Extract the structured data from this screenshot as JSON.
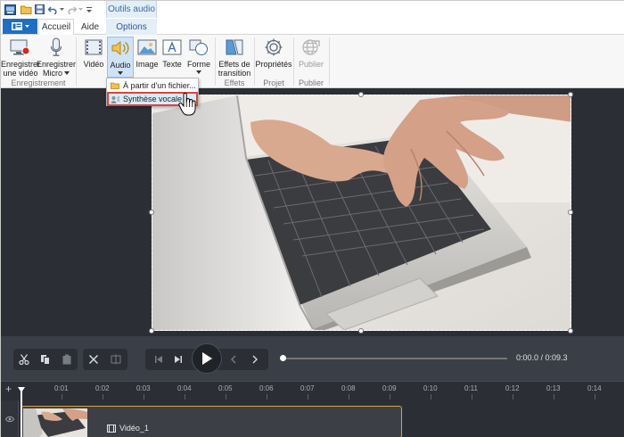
{
  "context_tab": {
    "title": "Outils audio",
    "tab": "Options"
  },
  "tabs": {
    "home": "Accueil",
    "help": "Aide"
  },
  "ribbon": {
    "record_screen": [
      "Enregistrer",
      "une vidéo"
    ],
    "record_mic": [
      "Enregistrer",
      "Micro"
    ],
    "video": "Vidéo",
    "audio": "Audio",
    "image": "Image",
    "text": "Texte",
    "shape": "Forme",
    "transitions": [
      "Effets de",
      "transition"
    ],
    "properties": "Propriétés",
    "publish": "Publier",
    "groups": {
      "recording": "Enregistrement",
      "effects": "Effets",
      "project": "Projet",
      "publish": "Publier"
    }
  },
  "audio_menu": {
    "from_file": "À partir d'un fichier...",
    "tts": "Synthèse vocale"
  },
  "transport": {
    "timecode": "0:00.0 / 0:09.3",
    "position": 0.0
  },
  "timeline": {
    "ticks": [
      "0:01",
      "0:02",
      "0:03",
      "0:04",
      "0:05",
      "0:06",
      "0:07",
      "0:08",
      "0:09",
      "0:10",
      "0:11",
      "0:12",
      "0:13",
      "0:14"
    ],
    "clip_name": "Vidéo_1"
  },
  "colors": {
    "accent": "#1e6fc4",
    "highlight_border": "#d9443c",
    "clip_border": "#d9a441",
    "dark_bg": "#2b2e35"
  }
}
